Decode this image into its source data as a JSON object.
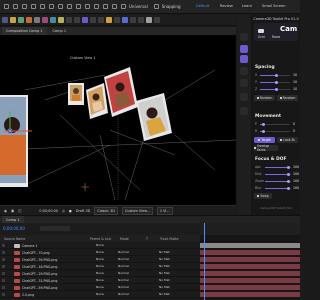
{
  "topbar": {
    "left_items": [
      "Universal",
      "Snapping"
    ],
    "workspaces": [
      "Default",
      "Review",
      "Learn",
      "Small Screen"
    ],
    "active_workspace": "Default"
  },
  "comp": {
    "tab_label": "Composition Comp 1",
    "sub_tab": "Comp 1",
    "camera_label": "Custom View 1"
  },
  "viewer_footer": {
    "timecode": "0;00;00;00",
    "draft": "Draft 3D",
    "view": "Classic 3D",
    "custom": "Custom View...",
    "views": "1 Vi..."
  },
  "plugin": {
    "title": "Camera3D Toolkit Pro V1.0",
    "header_word": "Cam",
    "tabs": [
      "Grid",
      "Rows"
    ],
    "sections": {
      "spacing": "Spacing",
      "movement": "Movement",
      "focus": "Focus & DOF"
    },
    "spacing_labels": [
      "X",
      "Y",
      "Z"
    ],
    "spacing_values": [
      "10",
      "10",
      "10"
    ],
    "random": [
      "Random",
      "Random"
    ],
    "movement_labels": [
      "P",
      "R"
    ],
    "movement_values": [
      "0",
      "0"
    ],
    "move_buttons": [
      "Target",
      "Look At"
    ],
    "overlap": "Overlap Faces",
    "focus_labels": [
      "Apt.",
      "Dist.",
      "Zoom",
      "Blur"
    ],
    "focus_values": [
      "100",
      "100",
      "100",
      "100"
    ],
    "swap": "Swap",
    "footer": "Camera3D Toolkit V1.0"
  },
  "timeline": {
    "tab": "Comp 1",
    "timecode": "0;00;00;00",
    "columns": [
      "Source Name",
      "Parent & Link",
      "Mode",
      "T",
      "Track Matte"
    ],
    "layers": [
      {
        "name": "Camera 1",
        "parent": "None",
        "mode": "",
        "track": "",
        "color": "#c0c0c0"
      },
      {
        "name": "ChatGPT...70.png",
        "parent": "None",
        "mode": "Normal",
        "track": "No Mat",
        "color": "#b94a4a"
      },
      {
        "name": "ChatGPT...39.PNG.png",
        "parent": "None",
        "mode": "Normal",
        "track": "No Mat",
        "color": "#b94a4a"
      },
      {
        "name": "ChatGPT...18.PNG.png",
        "parent": "None",
        "mode": "Normal",
        "track": "No Mat",
        "color": "#b94a4a"
      },
      {
        "name": "ChatGPT...29.PNG.png",
        "parent": "None",
        "mode": "Normal",
        "track": "No Mat",
        "color": "#b94a4a"
      },
      {
        "name": "ChatGPT...31.PNG.png",
        "parent": "None",
        "mode": "Normal",
        "track": "No Mat",
        "color": "#b94a4a"
      },
      {
        "name": "ChatGPT...59.PNG.png",
        "parent": "None",
        "mode": "Normal",
        "track": "No Mat",
        "color": "#b94a4a"
      },
      {
        "name": "2.0.png",
        "parent": "None",
        "mode": "Normal",
        "track": "No Mat",
        "color": "#b94a4a"
      }
    ]
  },
  "colors": {
    "accent": "#6d5bd0",
    "playhead": "#4f8cff",
    "layer_bar": "#7a3b45",
    "camera_bar": "#8a8a8a"
  }
}
